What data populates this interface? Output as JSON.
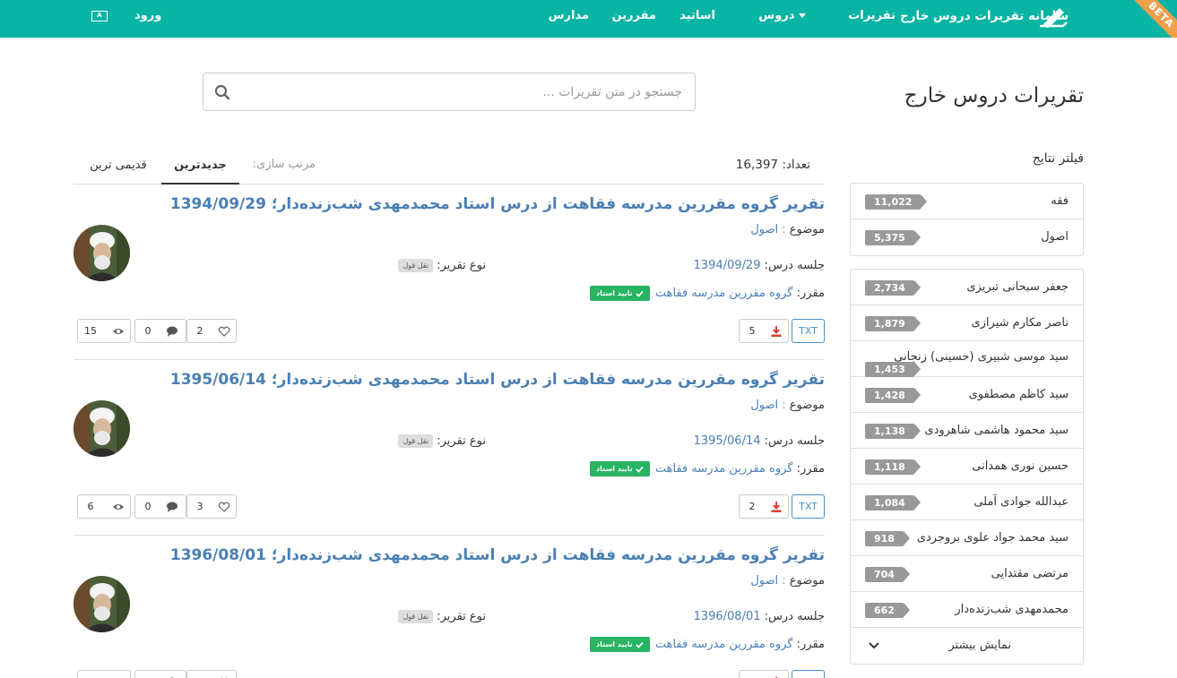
{
  "nav": {
    "brand": "سامانه تقریرات دروس خارج",
    "items": [
      "تقریرات",
      "دروس",
      "اساتید",
      "مقررین",
      "مدارس"
    ],
    "login": "ورود",
    "lang": "A",
    "beta": "BETA"
  },
  "page_title": "تقریرات دروس خارج",
  "search": {
    "placeholder": "جستجو در متن تقریرات ..."
  },
  "count": {
    "label": "تعداد:",
    "value": "16,397"
  },
  "sort": {
    "label": "مرتب سازی:",
    "tabs": [
      "جدیدترین",
      "قدیمی ترین"
    ]
  },
  "filter": {
    "title": "فیلتر نتایج",
    "subjects": [
      {
        "label": "فقه",
        "count": "11,022"
      },
      {
        "label": "اصول",
        "count": "5,375"
      }
    ],
    "teachers": [
      {
        "label": "جعفر سبحانی تبریزی",
        "count": "2,734"
      },
      {
        "label": "ناصر مکارم شیرازی",
        "count": "1,879"
      },
      {
        "label": "سید موسی شبیری (حسینی) زنجانی",
        "count": "1,453"
      },
      {
        "label": "سید کاظم مصطفوی",
        "count": "1,428"
      },
      {
        "label": "سید محمود هاشمی شاهرودی",
        "count": "1,138"
      },
      {
        "label": "حسین نوری همدانی",
        "count": "1,118"
      },
      {
        "label": "عبدالله جوادی آملی",
        "count": "1,084"
      },
      {
        "label": "سید محمد جواد علوی بروجردی",
        "count": "918"
      },
      {
        "label": "مرتضی مقتدایی",
        "count": "704"
      },
      {
        "label": "محمدمهدی شب‌زنده‌دار",
        "count": "662"
      }
    ],
    "show_more": "نمایش بیشتر"
  },
  "labels": {
    "subject": "موضوع",
    "session": "جلسه درس:",
    "type": "نوع تقریر:",
    "reporter": "مقرر:",
    "approved": "تایید استاد",
    "type_value": "نقل قول",
    "txt": "TXT"
  },
  "items": [
    {
      "title": "تقریر گروه مقررین مدرسه فقاهت از درس استاد محمدمهدی شب‌زنده‌دار؛ 1394/09/29",
      "subject": "اصول",
      "date": "1394/09/29",
      "reporter": "گروه مقررین مدرسه فقاهت",
      "downloads": "5",
      "likes": "2",
      "comments": "0",
      "views": "15"
    },
    {
      "title": "تقریر گروه مقررین مدرسه فقاهت از درس استاد محمدمهدی شب‌زنده‌دار؛ 1395/06/14",
      "subject": "اصول",
      "date": "1395/06/14",
      "reporter": "گروه مقررین مدرسه فقاهت",
      "downloads": "2",
      "likes": "3",
      "comments": "0",
      "views": "6"
    },
    {
      "title": "تقریر گروه مقررین مدرسه فقاهت از درس استاد محمدمهدی شب‌زنده‌دار؛ 1396/08/01",
      "subject": "اصول",
      "date": "1396/08/01",
      "reporter": "گروه مقررین مدرسه فقاهت",
      "downloads": "",
      "likes": "",
      "comments": "",
      "views": ""
    }
  ],
  "colors": {
    "navbar": "#08b4a4",
    "link": "#4a7fb5",
    "approved": "#28b463",
    "badge": "#999999",
    "beta": "#f0a04b"
  }
}
